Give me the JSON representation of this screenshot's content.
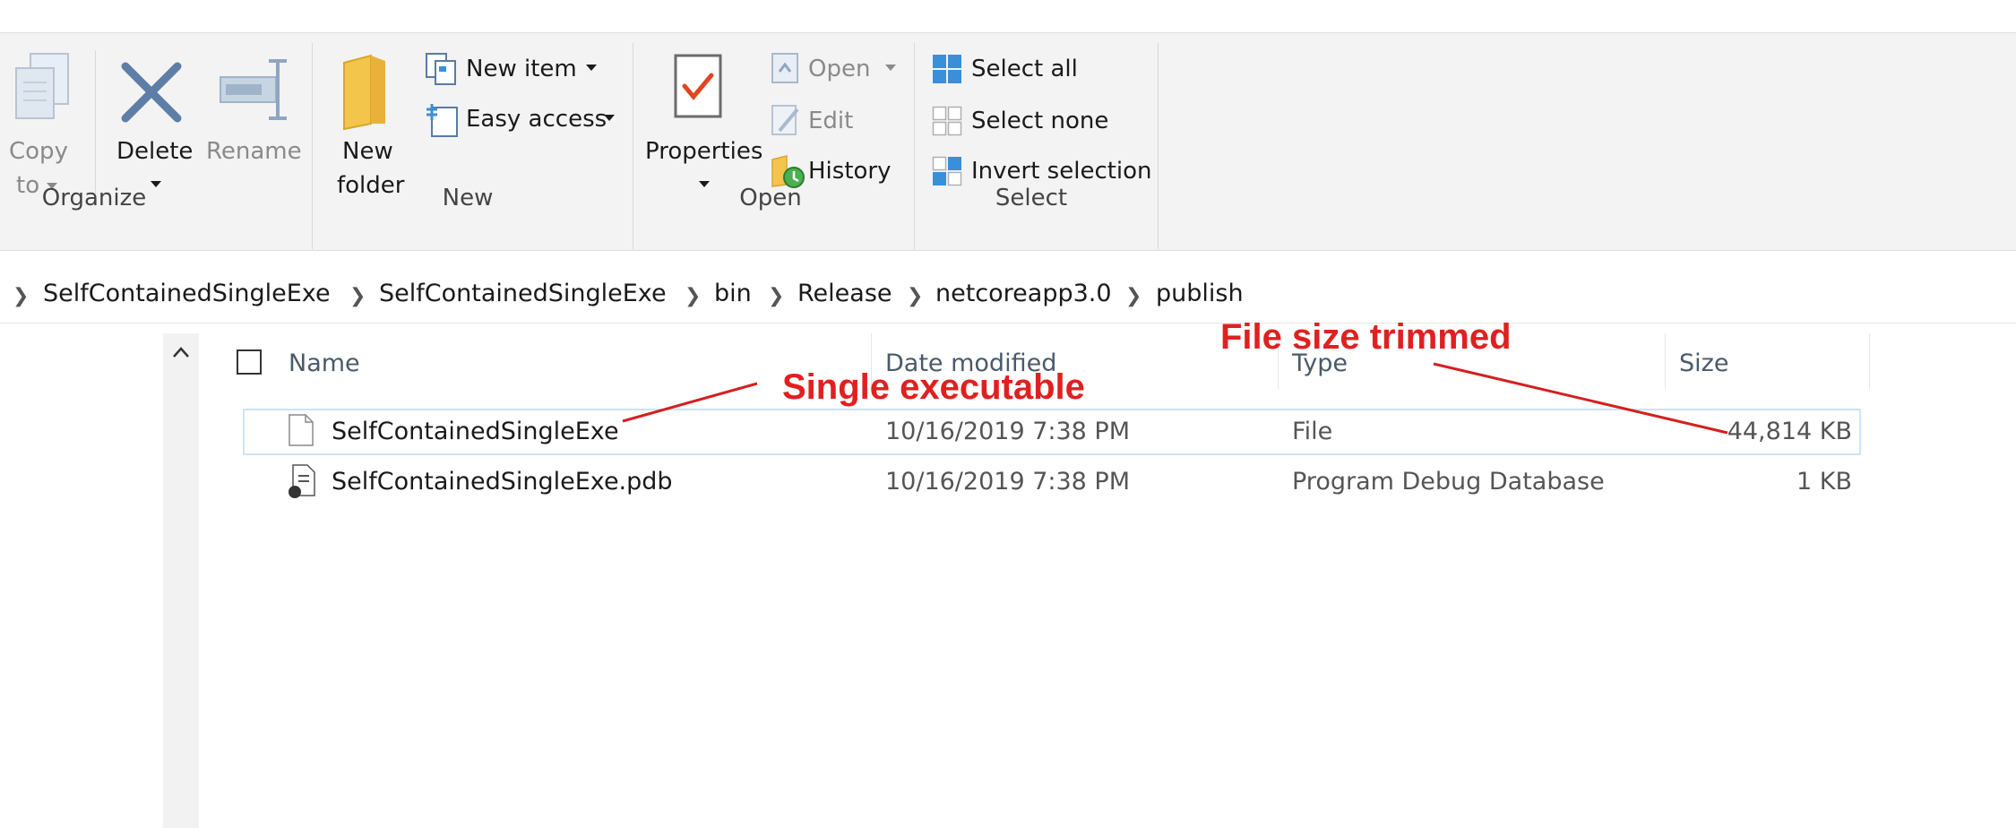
{
  "ribbon": {
    "organize": {
      "label": "Organize",
      "copy_to_line1": "Copy",
      "copy_to_line2": "to",
      "delete": "Delete",
      "rename": "Rename"
    },
    "new": {
      "label": "New",
      "new_folder_line1": "New",
      "new_folder_line2": "folder",
      "new_item": "New item",
      "easy_access": "Easy access"
    },
    "open": {
      "label": "Open",
      "properties": "Properties",
      "open": "Open",
      "edit": "Edit",
      "history": "History"
    },
    "select": {
      "label": "Select",
      "select_all": "Select all",
      "select_none": "Select none",
      "invert_selection": "Invert selection"
    }
  },
  "breadcrumb": [
    "SelfContainedSingleExe",
    "SelfContainedSingleExe",
    "bin",
    "Release",
    "netcoreapp3.0",
    "publish"
  ],
  "columns": {
    "name": "Name",
    "date_modified": "Date modified",
    "type": "Type",
    "size": "Size"
  },
  "files": [
    {
      "name": "SelfContainedSingleExe",
      "date": "10/16/2019 7:38 PM",
      "type": "File",
      "size": "44,814 KB",
      "icon": "file-icon"
    },
    {
      "name": "SelfContainedSingleExe.pdb",
      "date": "10/16/2019 7:38 PM",
      "type": "Program Debug Database",
      "size": "1 KB",
      "icon": "pdb-file-icon"
    }
  ],
  "annotations": {
    "single_executable": "Single executable",
    "file_size_trimmed": "File size trimmed"
  },
  "colors": {
    "annotation": "#e02020",
    "selection_border": "#cce4f7",
    "ribbon_bg": "#f3f3f3",
    "accent_blue": "#3a8fd9"
  }
}
